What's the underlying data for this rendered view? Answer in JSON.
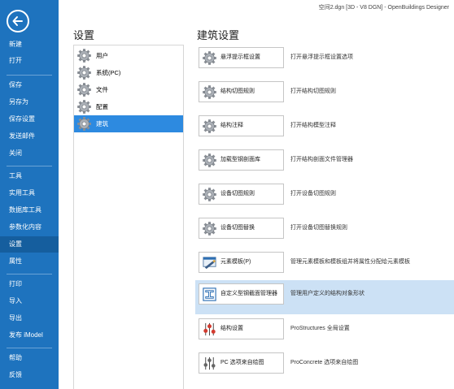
{
  "window": {
    "title": "空间2.dgn [3D - V8 DGN] - OpenBuildings Designer"
  },
  "nav": {
    "items": [
      {
        "label": "新建"
      },
      {
        "label": "打开"
      },
      {
        "label": "保存"
      },
      {
        "label": "另存为"
      },
      {
        "label": "保存设置"
      },
      {
        "label": "发送邮件"
      },
      {
        "label": "关闭"
      },
      {
        "label": "工具"
      },
      {
        "label": "实用工具"
      },
      {
        "label": "数据库工具"
      },
      {
        "label": "参数化内容"
      },
      {
        "label": "设置"
      },
      {
        "label": "属性"
      },
      {
        "label": "打印"
      },
      {
        "label": "导入"
      },
      {
        "label": "导出"
      },
      {
        "label": "发布 iModel"
      },
      {
        "label": "帮助"
      },
      {
        "label": "反馈"
      }
    ],
    "active": "设置"
  },
  "settings": {
    "title": "设置",
    "items": [
      {
        "label": "用户"
      },
      {
        "label": "系统(PC)"
      },
      {
        "label": "文件"
      },
      {
        "label": "配置"
      },
      {
        "label": "建筑"
      }
    ],
    "selected": "建筑"
  },
  "building": {
    "title": "建筑设置",
    "rows": [
      {
        "button": "悬浮提示框设置",
        "desc": "打开悬浮提示框设置选项",
        "icon": "gear-icon"
      },
      {
        "button": "结构切图规则",
        "desc": "打开结构切图规则",
        "icon": "gear-icon"
      },
      {
        "button": "结构注释",
        "desc": "打开结构模型注释",
        "icon": "gear-icon"
      },
      {
        "button": "加载型钢剖面库",
        "desc": "打开结构剖面文件管理器",
        "icon": "gear-icon"
      },
      {
        "button": "设备切图规则",
        "desc": "打开设备切图规则",
        "icon": "gear-icon"
      },
      {
        "button": "设备切图替换",
        "desc": "打开设备切图替换规则",
        "icon": "gear-icon"
      },
      {
        "button": "元素模板(P)",
        "desc": "管理元素模板和模板组并将属性分配给元素模板",
        "icon": "element-template-icon"
      },
      {
        "button": "自定义型钢截面管理器",
        "desc": "管理用户定义的结构对象形状",
        "icon": "section-manager-icon"
      },
      {
        "button": "结构设置",
        "desc": "ProStructures 全局设置",
        "icon": "sliders-icon"
      },
      {
        "button": "PC 选项来自绘图",
        "desc": "ProConcrete 选项来自绘图",
        "icon": "pc-sliders-icon"
      }
    ],
    "highlighted_row": "自定义型钢截面管理器"
  },
  "colors": {
    "nav_bg": "#1e73be",
    "nav_active": "#155e9e",
    "selection": "#2d8ae0",
    "row_highlight": "#cce1f5"
  }
}
